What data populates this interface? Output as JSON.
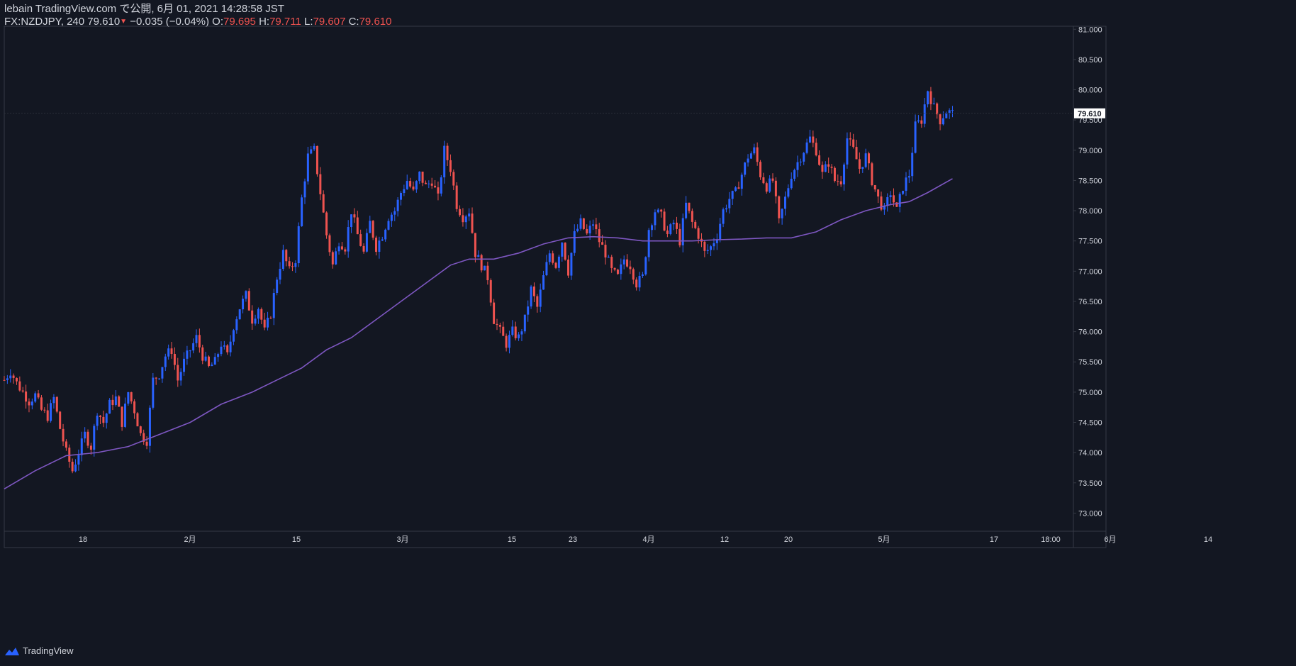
{
  "header": {
    "publisher": "lebain TradingView.com で公開, 6月 01, 2021 14:28:58 JST",
    "symbol": "FX:NZDJPY, 240",
    "last": "79.610",
    "change": "−0.035 (−0.04%)",
    "o_label": "O:",
    "o_value": "79.695",
    "h_label": "H:",
    "h_value": "79.711",
    "l_label": "L:",
    "l_value": "79.607",
    "c_label": "C:",
    "c_value": "79.610"
  },
  "footer": {
    "brand": "TradingView",
    "icon": "tradingview-logo-icon"
  },
  "colors": {
    "up": "#2962ff",
    "down": "#ef5350",
    "ma": "#7e57c2",
    "bg": "#131722",
    "grid": "#363a45",
    "text": "#d1d4dc"
  },
  "chart_data": {
    "type": "candlestick",
    "symbol": "FX:NZDJPY",
    "interval": "240",
    "ylim": [
      72.7,
      81.05
    ],
    "y_ticks": [
      "73.000",
      "73.500",
      "74.000",
      "74.500",
      "75.000",
      "75.500",
      "76.000",
      "76.500",
      "77.000",
      "77.500",
      "78.000",
      "78.500",
      "79.000",
      "79.500",
      "80.000",
      "80.500",
      "81.000"
    ],
    "x_ticks": [
      "18",
      "2月",
      "15",
      "3月",
      "15",
      "23",
      "4月",
      "12",
      "20",
      "5月",
      "17",
      "18:00",
      "6月",
      "14"
    ],
    "price_label": "79.610",
    "close_path": [
      [
        0,
        75.2
      ],
      [
        2,
        75.35
      ],
      [
        4,
        75.15
      ],
      [
        6,
        75.0
      ],
      [
        8,
        74.85
      ],
      [
        10,
        74.95
      ],
      [
        12,
        74.7
      ],
      [
        14,
        74.6
      ],
      [
        16,
        74.9
      ],
      [
        18,
        74.4
      ],
      [
        20,
        74.0
      ],
      [
        22,
        73.7
      ],
      [
        24,
        74.0
      ],
      [
        26,
        74.3
      ],
      [
        28,
        74.1
      ],
      [
        30,
        74.7
      ],
      [
        32,
        74.5
      ],
      [
        34,
        74.8
      ],
      [
        36,
        74.9
      ],
      [
        38,
        74.5
      ],
      [
        40,
        75.0
      ],
      [
        42,
        74.7
      ],
      [
        44,
        74.3
      ],
      [
        46,
        74.2
      ],
      [
        48,
        75.2
      ],
      [
        50,
        75.3
      ],
      [
        52,
        75.6
      ],
      [
        54,
        75.7
      ],
      [
        56,
        75.2
      ],
      [
        58,
        75.5
      ],
      [
        60,
        75.7
      ],
      [
        62,
        75.9
      ],
      [
        64,
        75.6
      ],
      [
        66,
        75.4
      ],
      [
        68,
        75.5
      ],
      [
        70,
        75.8
      ],
      [
        72,
        75.6
      ],
      [
        74,
        76.1
      ],
      [
        76,
        76.4
      ],
      [
        78,
        76.6
      ],
      [
        80,
        76.2
      ],
      [
        82,
        76.4
      ],
      [
        84,
        76.0
      ],
      [
        86,
        76.3
      ],
      [
        88,
        76.9
      ],
      [
        90,
        77.3
      ],
      [
        92,
        77.0
      ],
      [
        94,
        77.2
      ],
      [
        96,
        78.2
      ],
      [
        98,
        78.9
      ],
      [
        100,
        79.0
      ],
      [
        102,
        78.3
      ],
      [
        104,
        77.6
      ],
      [
        106,
        77.1
      ],
      [
        108,
        77.5
      ],
      [
        110,
        77.4
      ],
      [
        112,
        78.0
      ],
      [
        114,
        77.6
      ],
      [
        116,
        77.3
      ],
      [
        118,
        77.8
      ],
      [
        120,
        77.4
      ],
      [
        122,
        77.6
      ],
      [
        124,
        77.9
      ],
      [
        126,
        78.0
      ],
      [
        128,
        78.3
      ],
      [
        130,
        78.5
      ],
      [
        132,
        78.3
      ],
      [
        134,
        78.6
      ],
      [
        136,
        78.4
      ],
      [
        138,
        78.5
      ],
      [
        140,
        78.2
      ],
      [
        142,
        79.0
      ],
      [
        144,
        78.7
      ],
      [
        146,
        78.1
      ],
      [
        148,
        77.9
      ],
      [
        150,
        78.0
      ],
      [
        152,
        77.3
      ],
      [
        154,
        77.1
      ],
      [
        156,
        76.9
      ],
      [
        158,
        76.2
      ],
      [
        160,
        76.0
      ],
      [
        162,
        75.8
      ],
      [
        164,
        76.0
      ],
      [
        166,
        75.9
      ],
      [
        168,
        76.2
      ],
      [
        170,
        76.7
      ],
      [
        172,
        76.4
      ],
      [
        174,
        76.9
      ],
      [
        176,
        77.3
      ],
      [
        178,
        77.1
      ],
      [
        180,
        77.5
      ],
      [
        182,
        77.0
      ],
      [
        184,
        77.6
      ],
      [
        186,
        77.8
      ],
      [
        188,
        77.6
      ],
      [
        190,
        77.8
      ],
      [
        192,
        77.5
      ],
      [
        194,
        77.3
      ],
      [
        196,
        77.0
      ],
      [
        198,
        76.9
      ],
      [
        200,
        77.2
      ],
      [
        202,
        77.1
      ],
      [
        204,
        76.8
      ],
      [
        206,
        76.9
      ],
      [
        208,
        77.7
      ],
      [
        210,
        78.0
      ],
      [
        212,
        77.9
      ],
      [
        214,
        77.6
      ],
      [
        216,
        77.8
      ],
      [
        218,
        77.5
      ],
      [
        220,
        78.1
      ],
      [
        222,
        77.8
      ],
      [
        224,
        77.6
      ],
      [
        226,
        77.3
      ],
      [
        228,
        77.4
      ],
      [
        230,
        77.6
      ],
      [
        232,
        78.0
      ],
      [
        234,
        78.2
      ],
      [
        236,
        78.3
      ],
      [
        238,
        78.6
      ],
      [
        240,
        78.9
      ],
      [
        242,
        79.0
      ],
      [
        244,
        78.6
      ],
      [
        246,
        78.4
      ],
      [
        248,
        78.5
      ],
      [
        250,
        77.8
      ],
      [
        252,
        78.2
      ],
      [
        254,
        78.6
      ],
      [
        256,
        78.8
      ],
      [
        258,
        79.0
      ],
      [
        260,
        79.2
      ],
      [
        262,
        79.0
      ],
      [
        264,
        78.6
      ],
      [
        266,
        78.8
      ],
      [
        268,
        78.5
      ],
      [
        270,
        78.5
      ],
      [
        272,
        79.2
      ],
      [
        274,
        79.0
      ],
      [
        276,
        78.7
      ],
      [
        278,
        78.9
      ],
      [
        280,
        78.5
      ],
      [
        282,
        78.2
      ],
      [
        284,
        78.0
      ],
      [
        286,
        78.3
      ],
      [
        288,
        78.0
      ],
      [
        290,
        78.4
      ],
      [
        292,
        78.6
      ],
      [
        294,
        79.4
      ],
      [
        296,
        79.5
      ],
      [
        298,
        80.0
      ],
      [
        300,
        79.7
      ],
      [
        302,
        79.5
      ],
      [
        304,
        79.65
      ],
      [
        306,
        79.61
      ]
    ],
    "ma_series": {
      "name": "",
      "points": [
        [
          0,
          73.4
        ],
        [
          10,
          73.7
        ],
        [
          20,
          73.95
        ],
        [
          30,
          74.0
        ],
        [
          40,
          74.1
        ],
        [
          50,
          74.3
        ],
        [
          60,
          74.5
        ],
        [
          70,
          74.8
        ],
        [
          80,
          75.0
        ],
        [
          88,
          75.2
        ],
        [
          96,
          75.4
        ],
        [
          104,
          75.7
        ],
        [
          112,
          75.9
        ],
        [
          120,
          76.2
        ],
        [
          128,
          76.5
        ],
        [
          136,
          76.8
        ],
        [
          144,
          77.1
        ],
        [
          150,
          77.2
        ],
        [
          158,
          77.2
        ],
        [
          166,
          77.3
        ],
        [
          174,
          77.45
        ],
        [
          182,
          77.55
        ],
        [
          190,
          77.57
        ],
        [
          198,
          77.55
        ],
        [
          206,
          77.5
        ],
        [
          214,
          77.5
        ],
        [
          222,
          77.5
        ],
        [
          230,
          77.52
        ],
        [
          238,
          77.53
        ],
        [
          246,
          77.55
        ],
        [
          254,
          77.55
        ],
        [
          262,
          77.65
        ],
        [
          270,
          77.85
        ],
        [
          278,
          78.0
        ],
        [
          286,
          78.1
        ],
        [
          292,
          78.15
        ],
        [
          298,
          78.3
        ],
        [
          306,
          78.53
        ]
      ]
    },
    "x_max": 345
  }
}
